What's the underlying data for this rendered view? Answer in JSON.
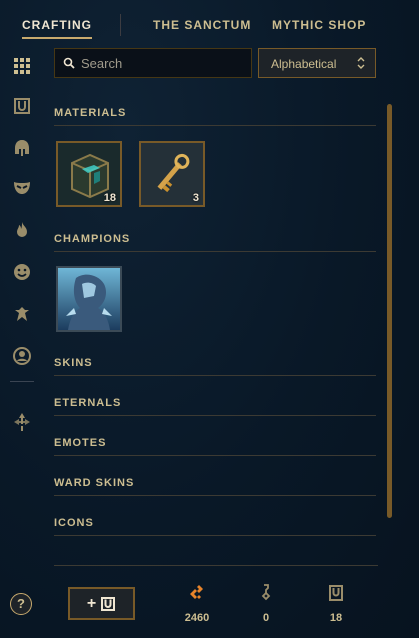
{
  "nav": {
    "tabs": [
      {
        "label": "CRAFTING"
      },
      {
        "label": "THE SANCTUM"
      },
      {
        "label": "MYTHIC SHOP"
      }
    ]
  },
  "search": {
    "placeholder": "Search",
    "value": ""
  },
  "sort": {
    "selected": "Alphabetical"
  },
  "sections": {
    "materials": {
      "title": "MATERIALS",
      "items": [
        {
          "name": "chest",
          "count": "18"
        },
        {
          "name": "key",
          "count": "3"
        }
      ]
    },
    "champions": {
      "title": "CHAMPIONS"
    },
    "skins": {
      "title": "SKINS"
    },
    "eternals": {
      "title": "ETERNALS"
    },
    "emotes": {
      "title": "EMOTES"
    },
    "ward_skins": {
      "title": "WARD SKINS"
    },
    "icons": {
      "title": "ICONS"
    }
  },
  "footer": {
    "help": "?",
    "add_label": "+",
    "currencies": [
      {
        "name": "orange-essence",
        "value": "2460"
      },
      {
        "name": "key-fragment",
        "value": "0"
      },
      {
        "name": "loot-chest",
        "value": "18"
      }
    ]
  },
  "colors": {
    "gold": "#c8aa6e",
    "text": "#cdbe91",
    "accent_orange": "#e8842a",
    "background": "#091827"
  },
  "icons": [
    "grid-icon",
    "chest-icon",
    "helmet-icon",
    "mask-icon",
    "flame-icon",
    "smiley-icon",
    "ward-icon",
    "profile-icon",
    "arrows-icon"
  ]
}
